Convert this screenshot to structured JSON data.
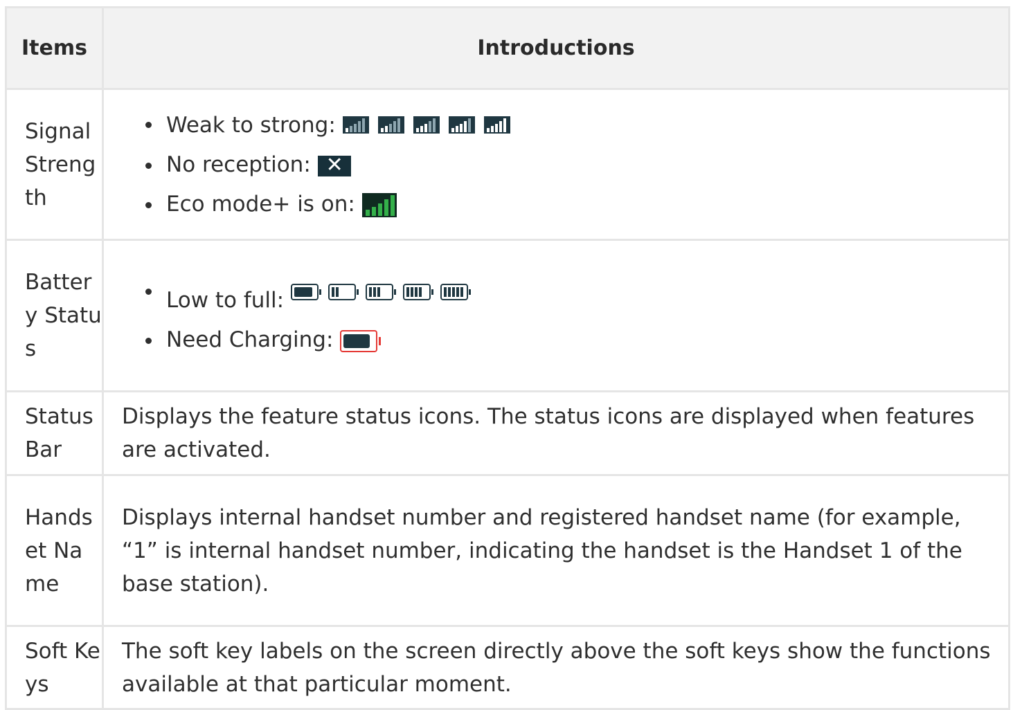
{
  "table": {
    "headers": {
      "item": "Items",
      "intro": "Introductions"
    },
    "rows": {
      "signal": {
        "item": "Signal Strength",
        "bullets": [
          "Weak to strong:",
          "No reception:",
          "Eco mode+ is on:"
        ],
        "levels": [
          1,
          2,
          3,
          4,
          5
        ]
      },
      "battery": {
        "item": "Battery Status",
        "bullets": [
          "Low to full:",
          "Need Charging:"
        ],
        "levels": [
          0,
          1,
          2,
          3,
          4
        ],
        "charge_color": "#e53935"
      },
      "status_bar": {
        "item": "Status Bar",
        "text": "Displays the feature status icons. The status icons are displayed when features are activated."
      },
      "handset": {
        "item": "Handset Name",
        "text": "Displays internal handset number and registered handset name (for example, “1” is internal handset number, indicating the handset is the Handset 1 of the base station)."
      },
      "soft_keys": {
        "item": "Soft Keys",
        "text": "The soft key labels on the screen directly above the soft keys show the functions available at that particular moment."
      }
    }
  },
  "colors": {
    "header_bg": "#f2f2f2",
    "border": "#e5e5e5",
    "eco_green": "#34b04a",
    "icon_dark": "#1f3741"
  }
}
